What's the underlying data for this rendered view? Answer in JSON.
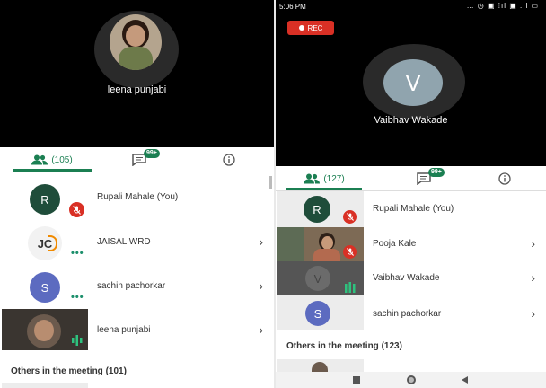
{
  "left": {
    "stage_name": "leena punjabi",
    "tabs": {
      "people": "(105)",
      "chat_badge": "99+"
    },
    "participants": [
      {
        "initial": "R",
        "name": "Rupali Mahale (You)",
        "muted": true
      },
      {
        "initial": "JC",
        "name": "JAISAL WRD",
        "muted": false
      },
      {
        "initial": "S",
        "name": "sachin pachorkar",
        "muted": false
      },
      {
        "initial": "",
        "name": "leena punjabi",
        "muted": false
      }
    ],
    "others": "Others in the meeting (101)"
  },
  "right": {
    "status_time": "5:06 PM",
    "rec_label": "REC",
    "stage_initial": "V",
    "stage_name": "Vaibhav Wakade",
    "tabs": {
      "people": "(127)",
      "chat_badge": "99+"
    },
    "participants": [
      {
        "initial": "R",
        "name": "Rupali Mahale (You)",
        "muted": true
      },
      {
        "initial": "",
        "name": "Pooja Kale",
        "muted": true
      },
      {
        "initial": "V",
        "name": "Vaibhav Wakade",
        "muted": false
      },
      {
        "initial": "S",
        "name": "sachin pachorkar",
        "muted": false
      }
    ],
    "others": "Others in the meeting (123)"
  },
  "colors": {
    "accent": "#1b7f52",
    "muted": "#d93025",
    "initial_green": "#1f4d3a",
    "initial_blue": "#5c6bc0"
  }
}
